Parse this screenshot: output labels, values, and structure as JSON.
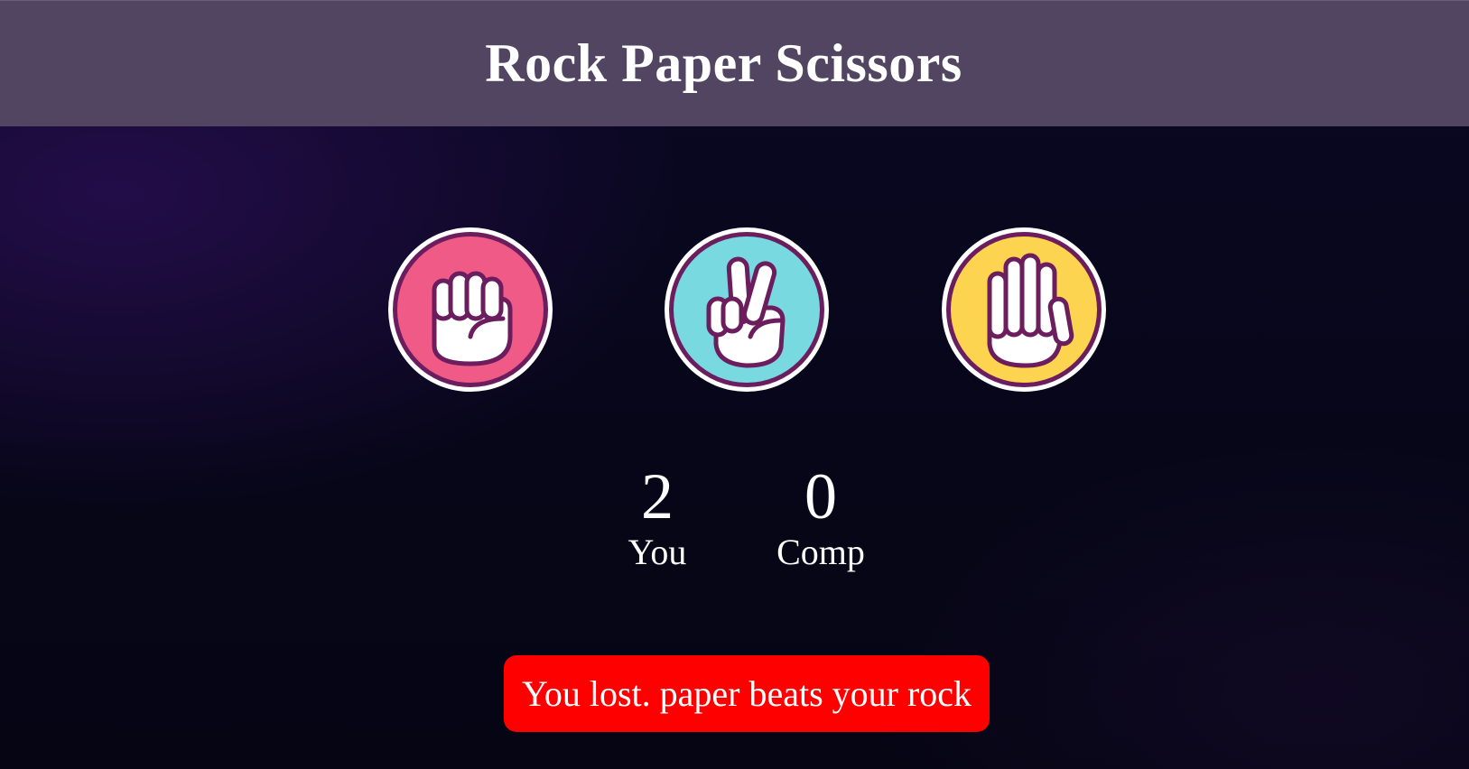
{
  "header": {
    "title": "Rock Paper Scissors"
  },
  "choices": [
    {
      "id": "rock",
      "icon": "fist-icon",
      "color": "#f05a86"
    },
    {
      "id": "scissors",
      "icon": "peace-hand-icon",
      "color": "#78d9e1"
    },
    {
      "id": "paper",
      "icon": "open-hand-icon",
      "color": "#fdd44f"
    }
  ],
  "scoreboard": {
    "user_score": "2",
    "user_label": "You",
    "comp_score": "0",
    "comp_label": "Comp"
  },
  "message": {
    "text": "You lost. paper beats your rock",
    "color": "#ff0000"
  },
  "colors": {
    "header_bg": "#514562",
    "background": "#070618",
    "icon_outline": "#6b1d5e"
  }
}
